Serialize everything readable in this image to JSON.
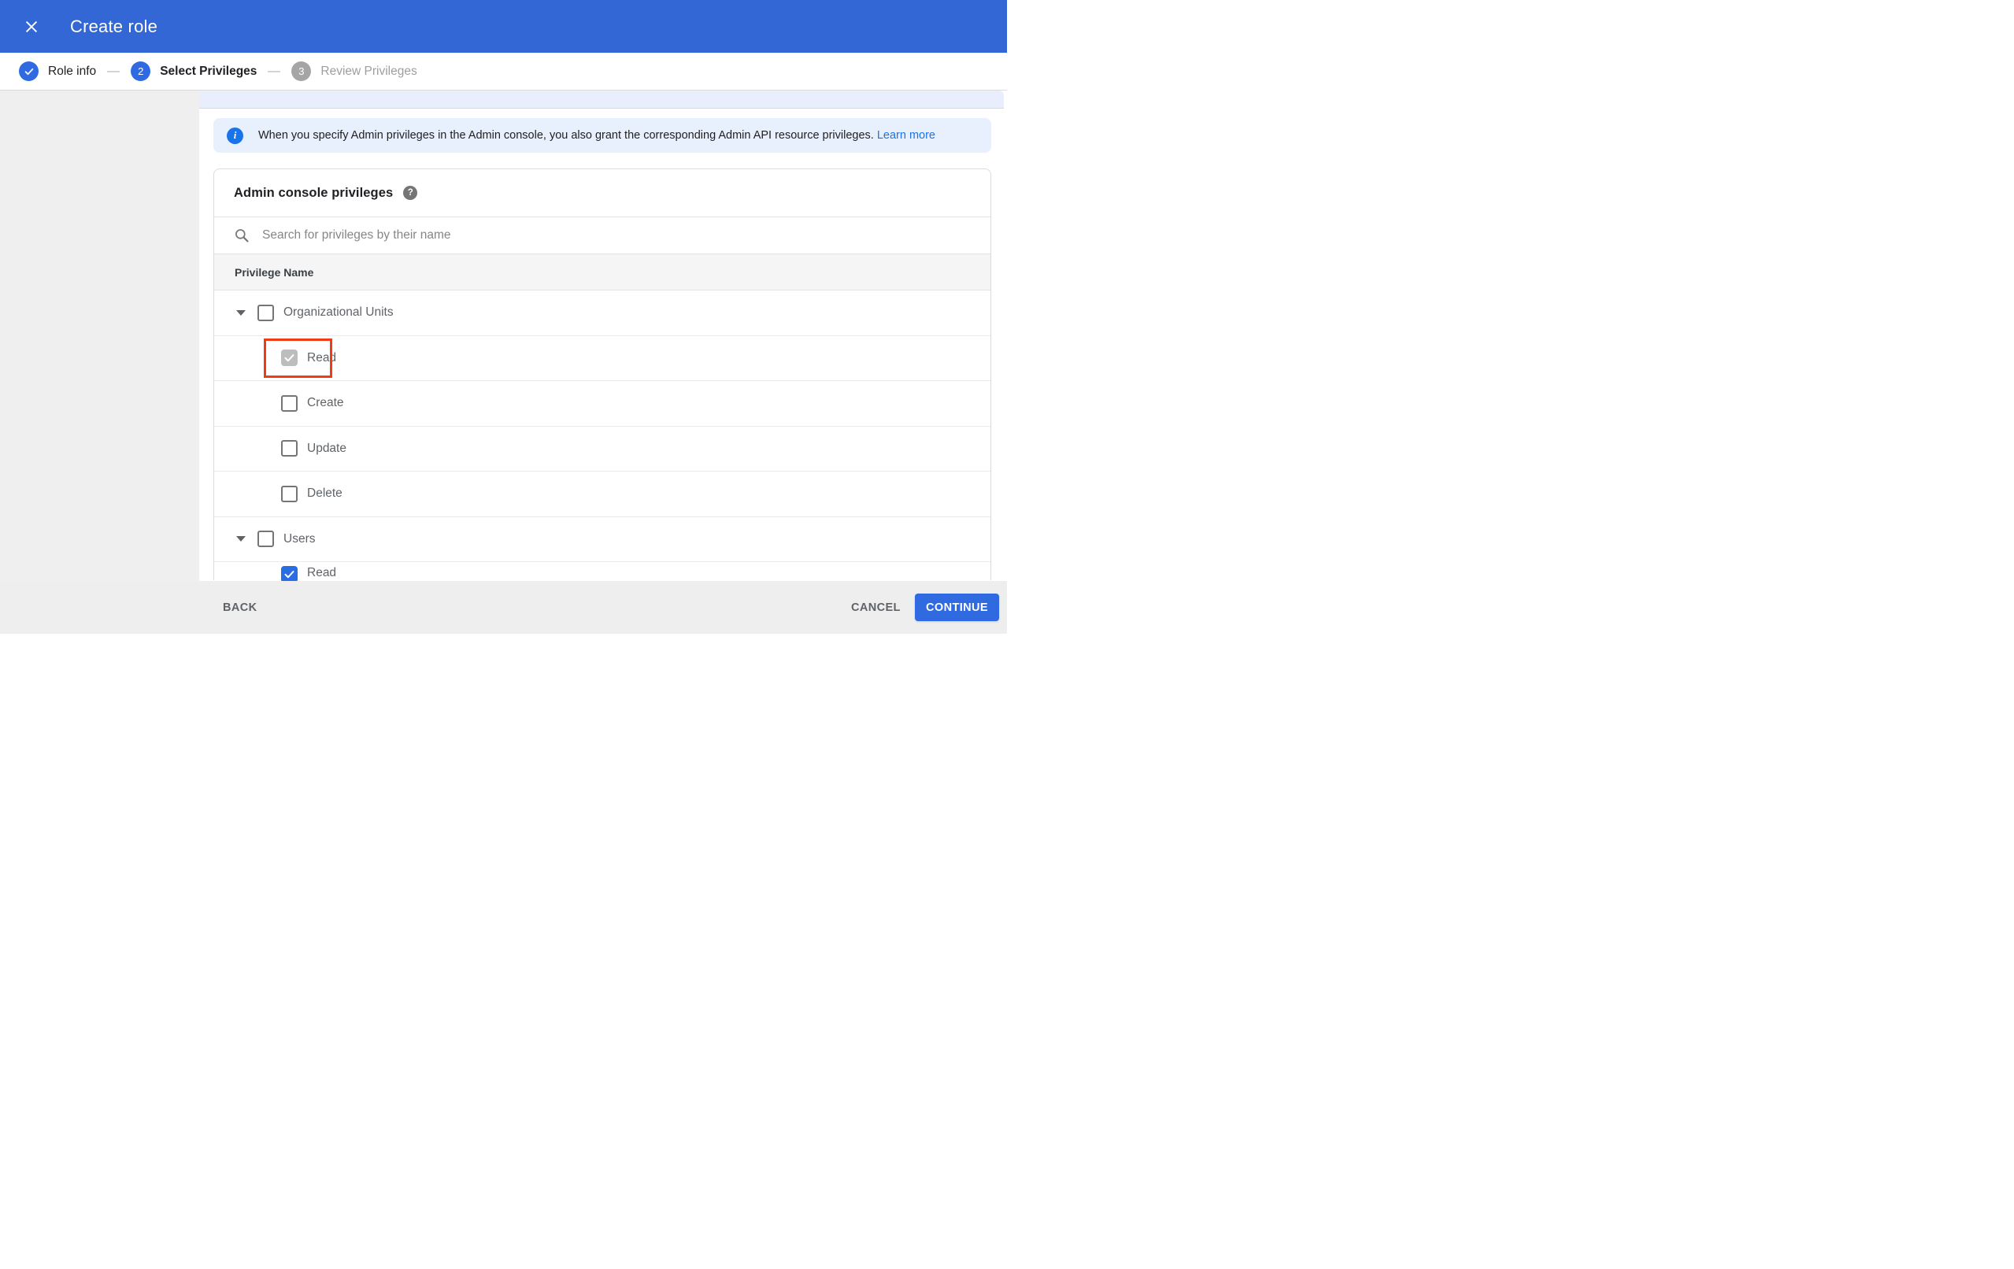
{
  "window": {
    "title": "Create role"
  },
  "stepper": {
    "steps": [
      {
        "label": "Role info",
        "state": "complete",
        "icon": "check"
      },
      {
        "number": "2",
        "label": "Select Privileges",
        "state": "active"
      },
      {
        "number": "3",
        "label": "Review Privileges",
        "state": "upcoming"
      }
    ]
  },
  "banner": {
    "icon_glyph": "i",
    "text": "When you specify Admin privileges in the Admin console, you also grant the corresponding Admin API resource privileges.",
    "link_label": "Learn more"
  },
  "privileges_card": {
    "title": "Admin console privileges",
    "help_icon_glyph": "?",
    "search_placeholder": "Search for privileges by their name",
    "search_value": "",
    "column_header": "Privilege Name",
    "rows": [
      {
        "label": "Organizational Units",
        "type": "group",
        "expanded": true,
        "checked": false
      },
      {
        "label": "Read",
        "type": "child",
        "checked": true,
        "checked_style": "gray",
        "highlighted": true
      },
      {
        "label": "Create",
        "type": "child",
        "checked": false
      },
      {
        "label": "Update",
        "type": "child",
        "checked": false
      },
      {
        "label": "Delete",
        "type": "child",
        "checked": false
      },
      {
        "label": "Users",
        "type": "group",
        "expanded": true,
        "checked": false
      },
      {
        "label": "Read",
        "type": "child",
        "checked": true,
        "checked_style": "blue",
        "partial": true
      }
    ]
  },
  "footer": {
    "back_label": "BACK",
    "cancel_label": "CANCEL",
    "continue_label": "CONTINUE"
  },
  "colors": {
    "appbar_blue": "#3367d6",
    "step_blue": "#2f6ae3",
    "banner_bg": "#e8f0fe",
    "link_blue": "#1a73e8",
    "checked_gray": "#bdbdbd",
    "checked_blue": "#2a6de3",
    "highlight_red": "#f13b15",
    "footer_bg": "#eeeeee",
    "left_panel_bg": "#efefef"
  }
}
